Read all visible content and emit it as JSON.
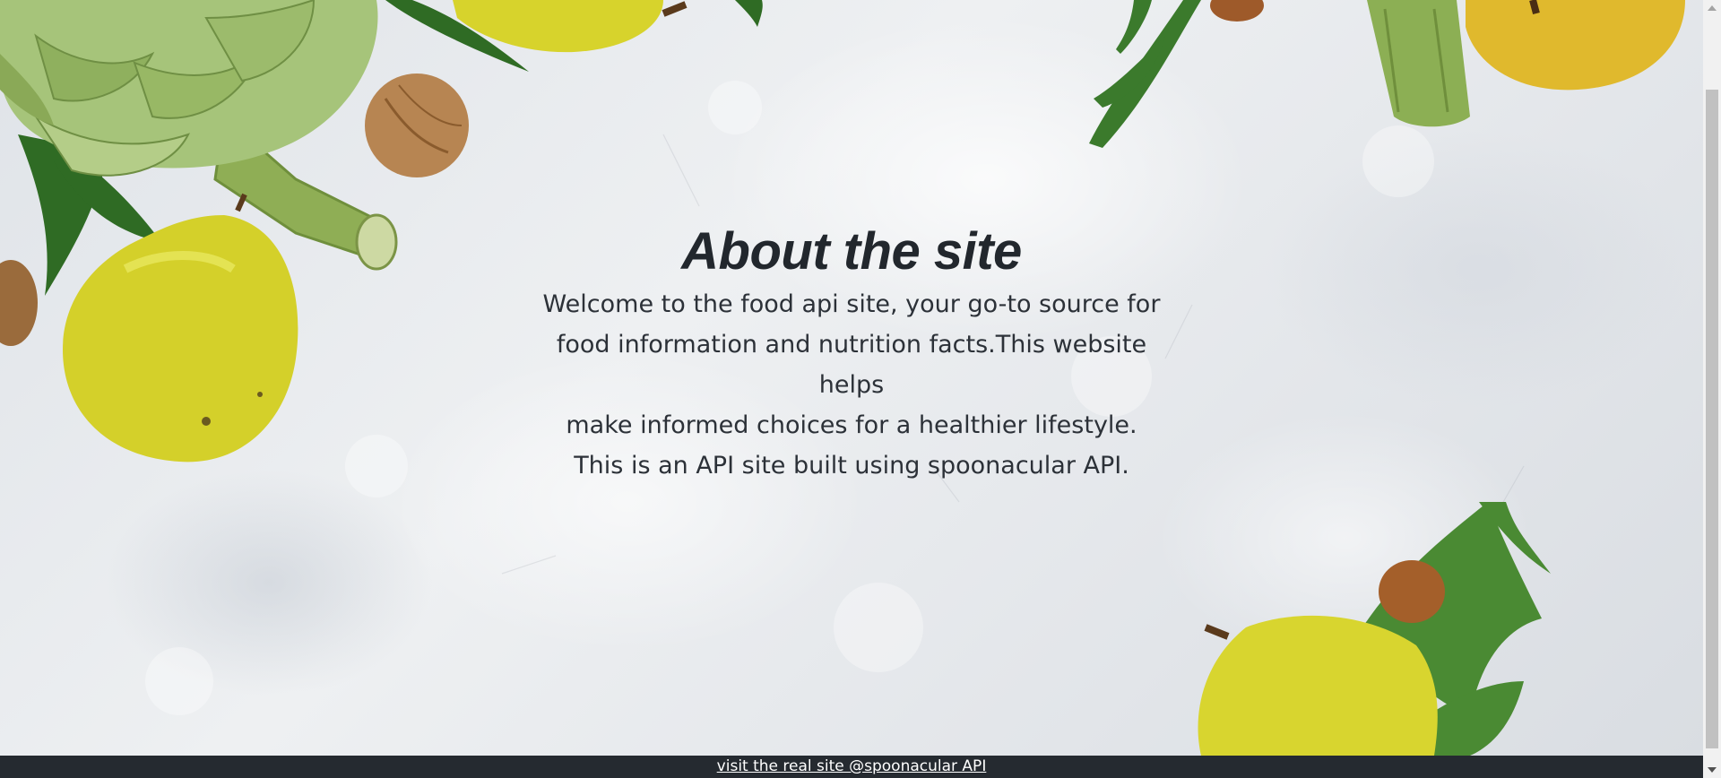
{
  "about": {
    "title": "About the site",
    "lines": [
      "Welcome to the food api site, your go-to source for",
      "food information and nutrition facts.This website",
      "helps",
      "make informed choices for a healthier lifestyle.",
      "This is an API site built using spoonacular API."
    ]
  },
  "footer": {
    "link_text": "visit the real site @spoonacular API"
  },
  "colors": {
    "footer_bg": "#252a30",
    "text": "#2c3138",
    "pear": "#d8d42a",
    "artichoke": "#9dbd6a",
    "leaf": "#3f7a2a",
    "walnut": "#b07a45"
  },
  "decorations": [
    "artichoke",
    "pear",
    "walnut",
    "hazelnut",
    "carrot-leaves"
  ]
}
